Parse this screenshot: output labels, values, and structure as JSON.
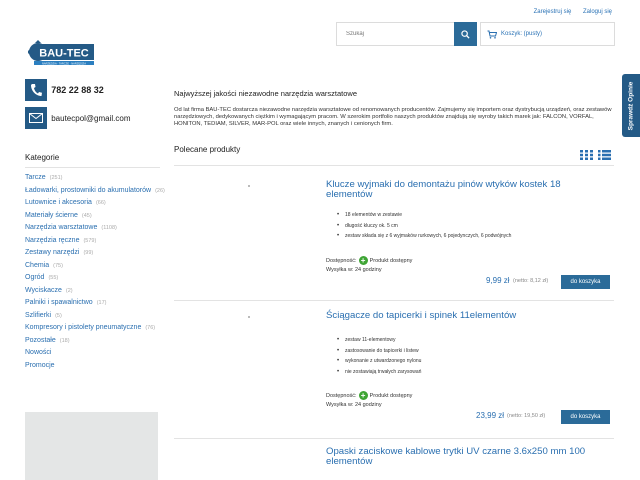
{
  "top_links": {
    "register": "Zarejestruj się",
    "login": "Zaloguj się"
  },
  "logo": {
    "text": "BAU-TEC",
    "tagline": "NARZĘDZIA · TARCZE · NARZĘDZIA"
  },
  "search": {
    "placeholder": "Szukaj"
  },
  "cart": {
    "label": "Koszyk: (pusty)"
  },
  "side_tab": {
    "label": "Sprawdź Opinie"
  },
  "contact": {
    "phone": "782 22 88 32",
    "email": "bautecpol@gmail.com"
  },
  "categories": {
    "title": "Kategorie",
    "items": [
      {
        "label": "Tarcze",
        "count": "(251)"
      },
      {
        "label": "Ładowarki, prostowniki do akumulatorów",
        "count": "(26)"
      },
      {
        "label": "Lutownice i akcesoria",
        "count": "(66)"
      },
      {
        "label": "Materiały ścierne",
        "count": "(45)"
      },
      {
        "label": "Narzędzia warsztatowe",
        "count": "(1108)"
      },
      {
        "label": "Narzędzia ręczne",
        "count": "(579)"
      },
      {
        "label": "Zestawy narzędzi",
        "count": "(99)"
      },
      {
        "label": "Chemia",
        "count": "(75)"
      },
      {
        "label": "Ogród",
        "count": "(55)"
      },
      {
        "label": "Wyciskacze",
        "count": "(2)"
      },
      {
        "label": "Palniki i spawalnictwo",
        "count": "(17)"
      },
      {
        "label": "Szlifierki",
        "count": "(5)"
      },
      {
        "label": "Kompresory i pistolety pneumatyczne",
        "count": "(76)"
      },
      {
        "label": "Pozostałe",
        "count": "(18)"
      },
      {
        "label": "Nowości",
        "count": ""
      },
      {
        "label": "Promocje",
        "count": ""
      }
    ]
  },
  "main": {
    "headline": "Najwyższej jakości niezawodne narzędzia warsztatowe",
    "intro": "Od lat firma BAU-TEC dostarcza niezawodne narzędzia warsztatowe od renomowanych producentów. Zajmujemy się importem oraz dystrybucją urządzeń, oraz zestawów narzędziowych, dedykowanych ciężkim i wymagającym pracom. W szerokim portfolio naszych produktów znajdują się wyroby takich marek jak: FALCON, VORFAL, HONITON, TEDIAM, SILVER, MAR-POL oraz wiele innych, znanych i cenionych firm.",
    "featured_title": "Polecane produkty"
  },
  "products": [
    {
      "name": "Klucze wyjmaki do demontażu pinów wtyków kostek 18 elementów",
      "features": [
        "18 elementów w zestawie",
        "długość kluczy ok. 5 cm",
        "zestaw składa się z 6 wyjmaków rurkowych, 6 pojedynczych, 6 podwójnych"
      ],
      "availability_label": "Dostępność:",
      "availability": "Produkt dostępny",
      "shipping": "Wysyłka w: 24 godziny",
      "price": "9,99 zł",
      "netto": "(netto: 8,12 zł)",
      "buy": "do koszyka"
    },
    {
      "name": "Ściągacze do tapicerki i spinek 11elementów",
      "features": [
        "zestaw 11-elementowy",
        "zastosowanie do tapicerki i listew",
        "wykonanie z utwardzonego nylonu",
        "nie zostawiają trwałych zarysowań"
      ],
      "availability_label": "Dostępność:",
      "availability": "Produkt dostępny",
      "shipping": "Wysyłka w: 24 godziny",
      "price": "23,99 zł",
      "netto": "(netto: 19,50 zł)",
      "buy": "do koszyka"
    },
    {
      "name": "Opaski zaciskowe kablowe trytki UV czarne 3.6x250 mm 100 elementów"
    }
  ],
  "colors": {
    "accent": "#2b6b99",
    "link": "#2a6fb0",
    "available": "#3fa535"
  }
}
